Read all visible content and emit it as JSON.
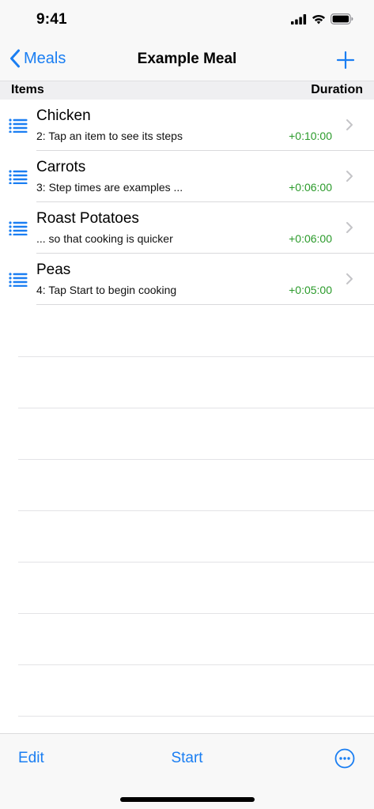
{
  "status_bar": {
    "time": "9:41"
  },
  "nav": {
    "back_label": "Meals",
    "title": "Example Meal"
  },
  "columns": {
    "items": "Items",
    "duration": "Duration"
  },
  "items": [
    {
      "title": "Chicken",
      "subtitle": "2: Tap an item to see its steps",
      "duration": "+0:10:00"
    },
    {
      "title": "Carrots",
      "subtitle": "3: Step times are examples ...",
      "duration": "+0:06:00"
    },
    {
      "title": "Roast Potatoes",
      "subtitle": "... so that cooking is quicker",
      "duration": "+0:06:00"
    },
    {
      "title": "Peas",
      "subtitle": "4: Tap Start to begin cooking",
      "duration": "+0:05:00"
    }
  ],
  "toolbar": {
    "edit_label": "Edit",
    "start_label": "Start"
  },
  "colors": {
    "accent": "#1a7ef2",
    "duration": "#2a9a2a",
    "chevron": "#c4c4c7"
  },
  "icons": {
    "row": "list-icon",
    "back": "chevron-left-icon",
    "add": "plus-icon",
    "more": "ellipsis-circle-icon"
  }
}
